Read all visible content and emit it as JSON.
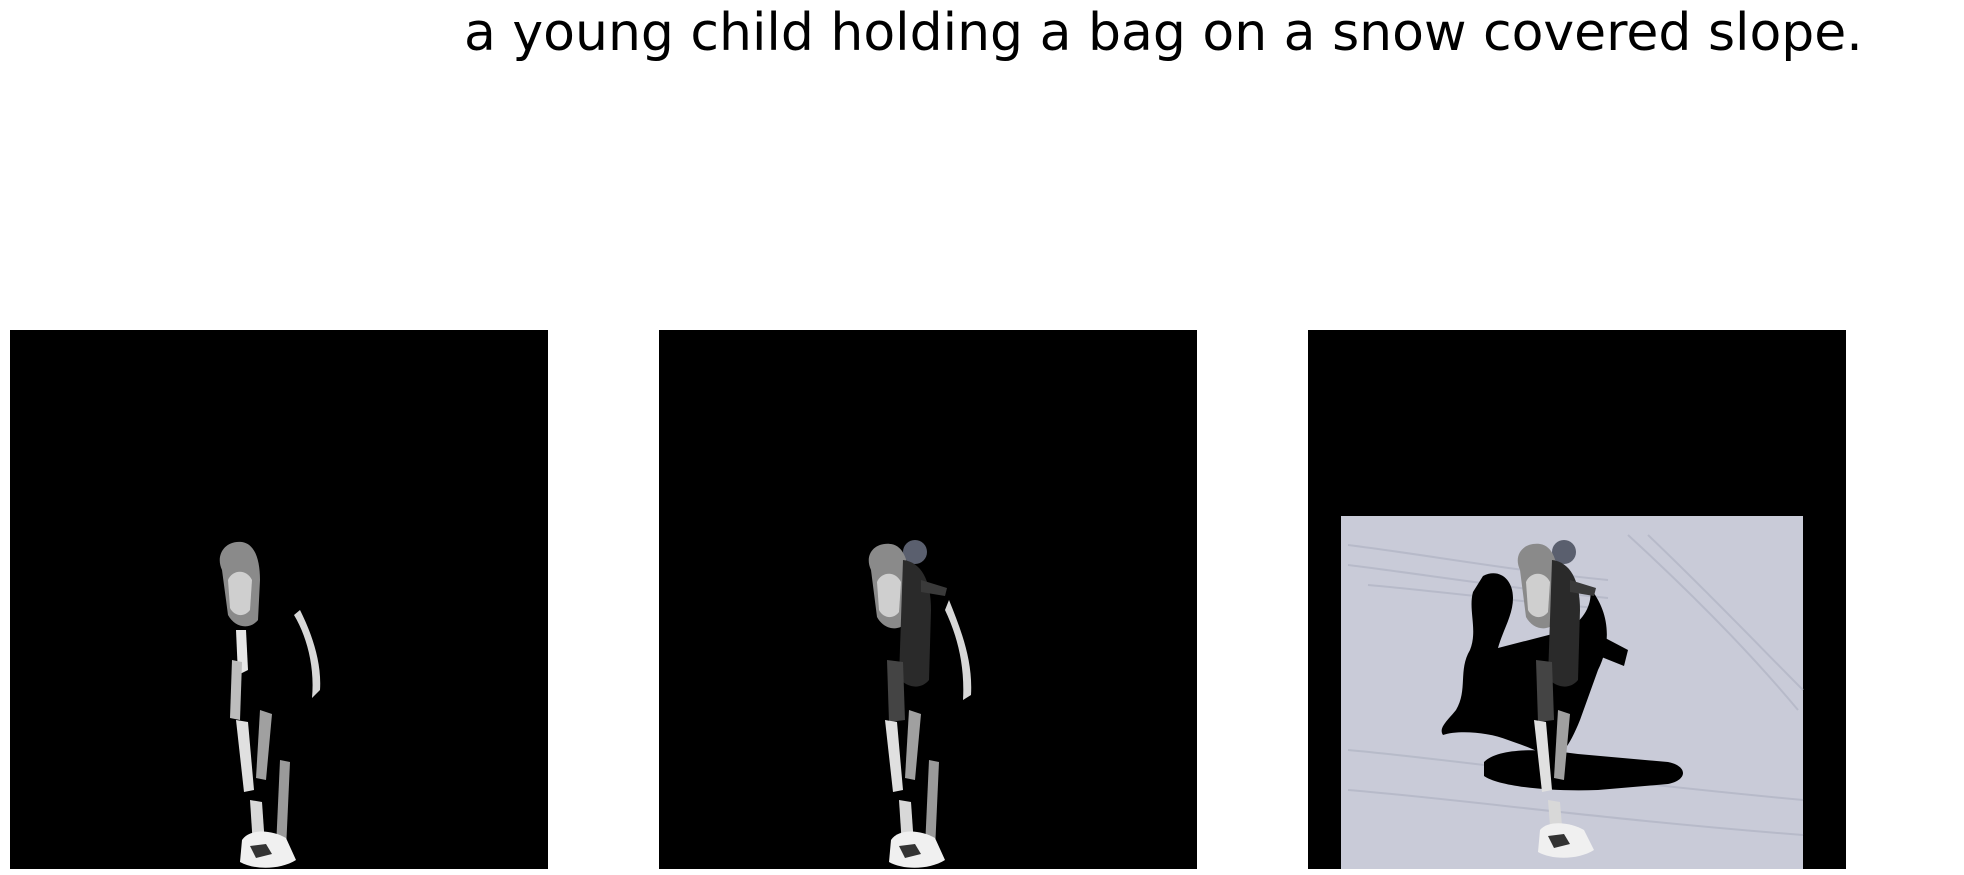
{
  "caption": "a young child holding a bag on a snow covered slope.",
  "panels": [
    {
      "id": "panel-1",
      "description": "partial figure mask of a snowboarder, black background"
    },
    {
      "id": "panel-2",
      "description": "fuller figure mask of a snowboarder, black background"
    },
    {
      "id": "panel-3",
      "description": "snowboarder on snowy slope with shadow, black margins"
    }
  ],
  "colors": {
    "background": "#ffffff",
    "panel_background": "#000000",
    "snow": "#c9cbd8",
    "figure_dark": "#111111",
    "figure_light": "#e6e6e6"
  }
}
